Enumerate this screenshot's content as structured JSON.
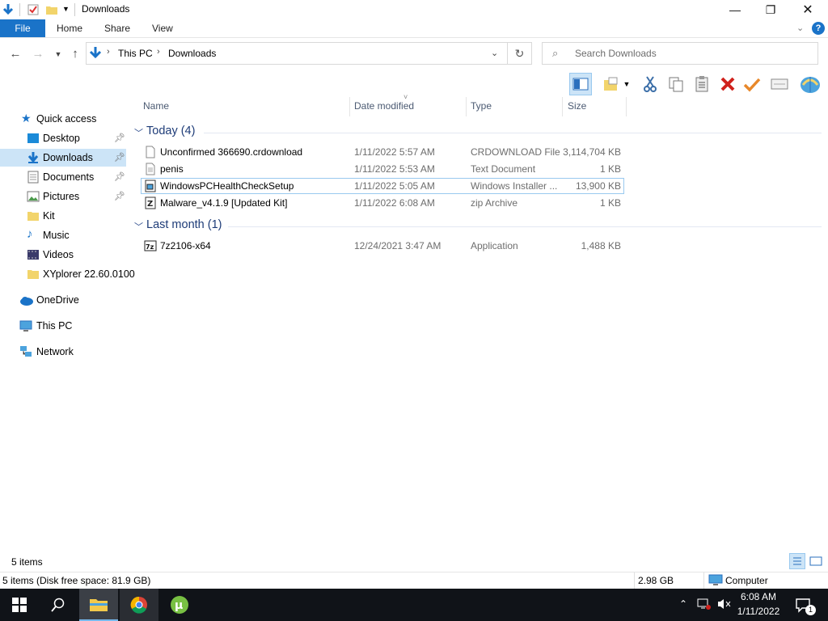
{
  "window": {
    "title": "Downloads"
  },
  "ribbon": {
    "tabs": [
      "File",
      "Home",
      "Share",
      "View"
    ]
  },
  "address": {
    "crumbs": [
      "This PC",
      "Downloads"
    ],
    "search_placeholder": "Search Downloads"
  },
  "nav": {
    "quick_access": "Quick access",
    "items": [
      {
        "label": "Desktop",
        "icon": "desktop-icon",
        "pinned": true
      },
      {
        "label": "Downloads",
        "icon": "downloads-icon",
        "pinned": true,
        "selected": true
      },
      {
        "label": "Documents",
        "icon": "documents-icon",
        "pinned": true
      },
      {
        "label": "Pictures",
        "icon": "pictures-icon",
        "pinned": true
      },
      {
        "label": "Kit",
        "icon": "folder-icon"
      },
      {
        "label": "Music",
        "icon": "music-icon"
      },
      {
        "label": "Videos",
        "icon": "videos-icon"
      },
      {
        "label": "XYplorer 22.60.0100",
        "icon": "folder-icon"
      }
    ],
    "onedrive": "OneDrive",
    "thispc": "This PC",
    "network": "Network"
  },
  "columns": {
    "name": "Name",
    "date": "Date modified",
    "type": "Type",
    "size": "Size"
  },
  "groups": [
    {
      "label": "Today (4)",
      "files": [
        {
          "name": "Unconfirmed 366690.crdownload",
          "date": "1/11/2022 5:57 AM",
          "type": "CRDOWNLOAD File",
          "size": "3,114,704 KB",
          "icon": "blank-file-icon"
        },
        {
          "name": "penis",
          "date": "1/11/2022 5:53 AM",
          "type": "Text Document",
          "size": "1 KB",
          "icon": "text-file-icon"
        },
        {
          "name": "WindowsPCHealthCheckSetup",
          "date": "1/11/2022 5:05 AM",
          "type": "Windows Installer ...",
          "size": "13,900 KB",
          "icon": "installer-icon",
          "selected": true
        },
        {
          "name": "Malware_v4.1.9 [Updated Kit]",
          "date": "1/11/2022 6:08 AM",
          "type": "zip Archive",
          "size": "1 KB",
          "icon": "zip-icon"
        }
      ]
    },
    {
      "label": "Last month (1)",
      "files": [
        {
          "name": "7z2106-x64",
          "date": "12/24/2021 3:47 AM",
          "type": "Application",
          "size": "1,488 KB",
          "icon": "7zip-icon"
        }
      ]
    }
  ],
  "status": {
    "items": "5 items",
    "detail": "5 items (Disk free space: 81.9 GB)",
    "size": "2.98 GB",
    "computer": "Computer"
  },
  "clock": {
    "time": "6:08 AM",
    "date": "1/11/2022"
  },
  "notifications": "1"
}
